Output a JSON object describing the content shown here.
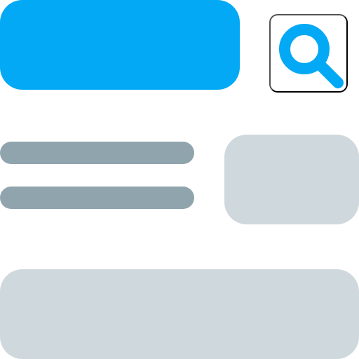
{
  "colors": {
    "accent": "#03A9F4",
    "text_line": "#90A4AE",
    "placeholder": "#CFD8DC",
    "background": "#FFFFFF"
  },
  "icons": {
    "search": "search-icon"
  }
}
